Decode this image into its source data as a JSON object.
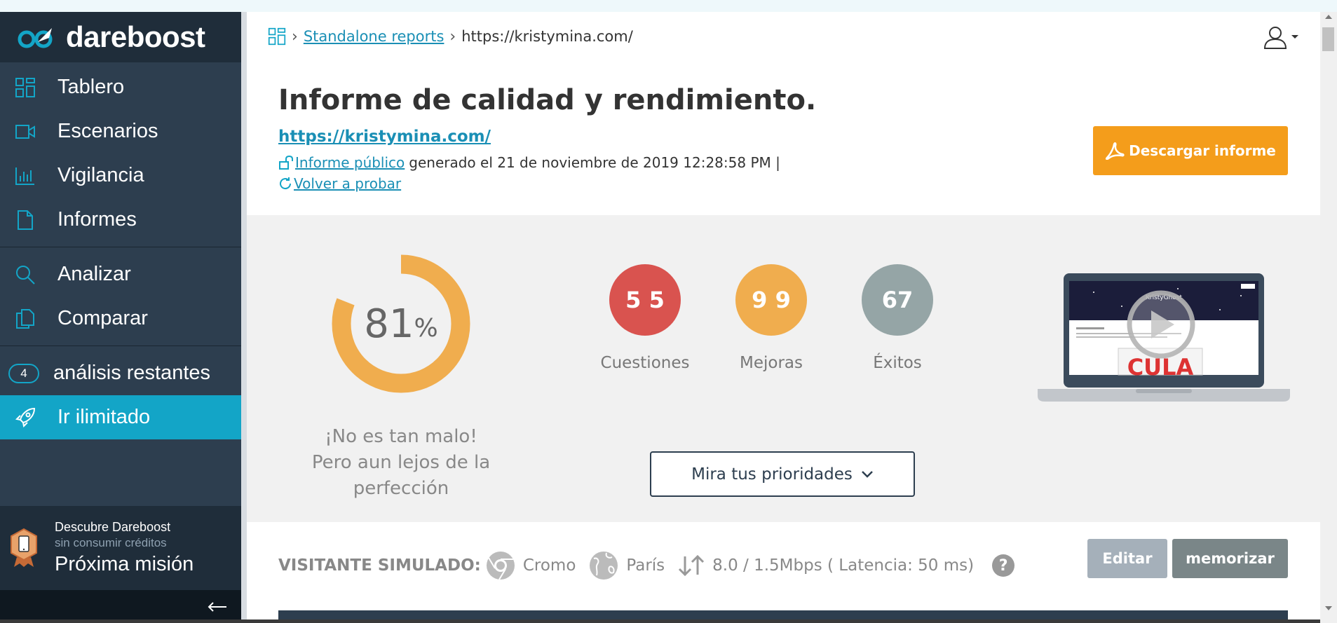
{
  "brand": {
    "name": "dareboost",
    "logo_icon": "rocket-logo-icon"
  },
  "sidebar": {
    "items": [
      {
        "label": "Tablero",
        "icon": "dashboard-icon"
      },
      {
        "label": "Escenarios",
        "icon": "video-icon"
      },
      {
        "label": "Vigilancia",
        "icon": "chart-icon"
      },
      {
        "label": "Informes",
        "icon": "document-icon"
      },
      {
        "label": "Analizar",
        "icon": "search-icon"
      },
      {
        "label": "Comparar",
        "icon": "copy-icon"
      }
    ],
    "remaining": {
      "count": "4",
      "label": "análisis restantes"
    },
    "unlimited": {
      "label": "Ir ilimitado",
      "icon": "rocket-icon"
    },
    "discover": {
      "line1": "Descubre Dareboost",
      "line2": "sin consumir créditos",
      "line3": "Próxima misión",
      "icon": "phone-badge-icon"
    },
    "collapse_icon": "arrow-left-icon"
  },
  "breadcrumb": {
    "home_icon": "dashboard-icon",
    "link": "Standalone reports",
    "current": "https://kristymina.com/"
  },
  "header": {
    "title": "Informe de calidad y rendimiento.",
    "site_url": "https://kristymina.com/",
    "public_link": "Informe público",
    "generated": "generado el 21 de noviembre de 2019 12:28:58 PM |",
    "retest": "Volver a probar",
    "download": "Descargar informe"
  },
  "score": {
    "value": "81",
    "unit": "%",
    "fraction": 0.81,
    "verdict_line1": "¡No es tan malo!",
    "verdict_line2": "Pero aun lejos de la perfección"
  },
  "badges": [
    {
      "value": "5 5",
      "label": "Cuestiones",
      "color": "#d9534f"
    },
    {
      "value": "9 9",
      "label": "Mejoras",
      "color": "#f0ad4e"
    },
    {
      "value": "67",
      "label": "Éxitos",
      "color": "#95a5a6"
    }
  ],
  "priorities_button": "Mira tus prioridades",
  "preview": {
    "site_title": "KristyGhost",
    "caption_text": "CULA"
  },
  "visitor": {
    "label": "VISITANTE SIMULADO:",
    "browser": "Cromo",
    "location": "París",
    "connection": "8.0 / 1.5Mbps ( Latencia: 50 ms)",
    "help": "?",
    "edit": "Editar",
    "memorize": "memorizar"
  },
  "colors": {
    "sidebar": "#2d3e4f",
    "accent": "#13a5c7",
    "download": "#f49d1b",
    "donut": "#f0ad4e"
  }
}
